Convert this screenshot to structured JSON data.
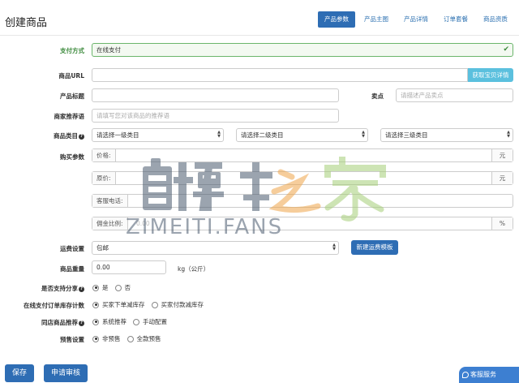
{
  "page": {
    "title": "创建商品"
  },
  "tabs": [
    {
      "label": "产品参数",
      "active": true
    },
    {
      "label": "产品主图",
      "active": false
    },
    {
      "label": "产品详情",
      "active": false
    },
    {
      "label": "订单套餐",
      "active": false
    },
    {
      "label": "商品资质",
      "active": false
    }
  ],
  "form": {
    "pay_method": {
      "label": "支付方式",
      "value": "在线支付"
    },
    "product_url": {
      "label": "商品URL",
      "value": "",
      "button": "获取宝贝详情"
    },
    "product_title": {
      "label": "产品标题",
      "value": ""
    },
    "selling_point": {
      "label": "卖点",
      "placeholder": "请描述产品卖点"
    },
    "recommend": {
      "label": "商家推荐语",
      "placeholder": "请填写您对该商品的推荐语"
    },
    "category": {
      "label": "商品类目",
      "level1": "请选择一级类目",
      "level2": "请选择二级类目",
      "level3": "请选择三级类目"
    },
    "purchase_params": {
      "label": "购买参数",
      "price": {
        "label": "价格:",
        "unit": "元"
      },
      "original_price": {
        "label": "原价:",
        "unit": "元"
      },
      "service_phone": {
        "label": "客服电话:"
      },
      "commission": {
        "label": "佣金比例:",
        "placeholder": "0.00",
        "unit": "%"
      }
    },
    "shipping": {
      "label": "运费设置",
      "value": "包邮",
      "button": "新建运费模板"
    },
    "weight": {
      "label": "商品重量",
      "value": "0.00",
      "unit": "kg（公斤）"
    },
    "share": {
      "label": "是否支持分享",
      "options": [
        "是",
        "否"
      ],
      "selected": 0
    },
    "stock_count": {
      "label": "在线支付订单库存计数",
      "options": [
        "买家下单减库存",
        "买家付款减库存"
      ],
      "selected": 0
    },
    "same_shop_recommend": {
      "label": "同店商品推荐",
      "options": [
        "系统推荐",
        "手动配置"
      ],
      "selected": 0
    },
    "presale": {
      "label": "预售设置",
      "options": [
        "非预售",
        "全款预售"
      ],
      "selected": 0
    }
  },
  "footer": {
    "save": "保存",
    "submit": "申请审核",
    "service": "客服服务"
  },
  "watermark": {
    "logo_text": "自媒体之家",
    "domain": "ZIMEITI.FANS"
  },
  "colors": {
    "primary": "#2e6db4",
    "info": "#5bc0de",
    "success": "#3c8a3c"
  }
}
